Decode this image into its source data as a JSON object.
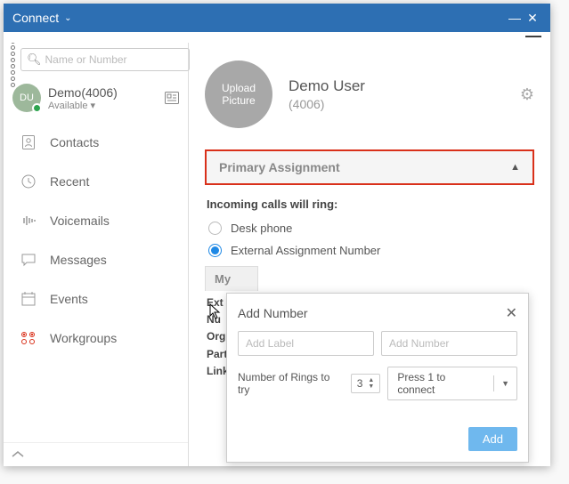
{
  "titlebar": {
    "title": "Connect"
  },
  "search": {
    "placeholder": "Name or Number"
  },
  "user": {
    "initials": "DU",
    "name": "Demo(4006)",
    "status": "Available"
  },
  "nav": {
    "contacts": "Contacts",
    "recent": "Recent",
    "voicemails": "Voicemails",
    "messages": "Messages",
    "events": "Events",
    "workgroups": "Workgroups"
  },
  "profile": {
    "upload": "Upload Picture",
    "name": "Demo User",
    "ext": "(4006)"
  },
  "section": {
    "title": "Primary Assignment",
    "subtitle": "Incoming calls will ring:",
    "opt_desk": "Desk phone",
    "opt_ext": "External Assignment Number"
  },
  "bg": {
    "my": "My",
    "l1": "Ext",
    "l2": "Nu",
    "l3": "Org",
    "l4": "Part",
    "l5": "Link"
  },
  "popup": {
    "title": "Add Number",
    "label_ph": "Add Label",
    "number_ph": "Add Number",
    "rings_label": "Number of Rings to try",
    "rings_value": "3",
    "connect_label": "Press 1 to connect",
    "add_btn": "Add"
  }
}
